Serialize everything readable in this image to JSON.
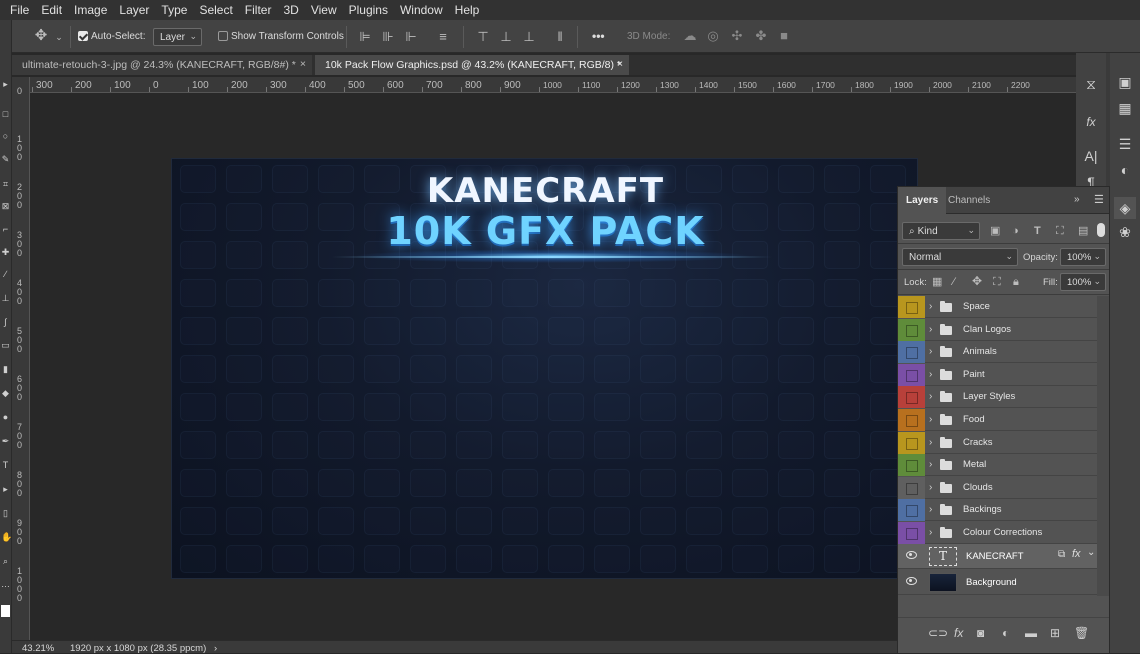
{
  "menu": [
    "File",
    "Edit",
    "Image",
    "Layer",
    "Type",
    "Select",
    "Filter",
    "3D",
    "View",
    "Plugins",
    "Window",
    "Help"
  ],
  "options": {
    "auto_select_label": "Auto-Select:",
    "auto_select_checked": true,
    "auto_select_target": "Layer",
    "show_transform_label": "Show Transform Controls",
    "show_transform_checked": false,
    "more_label": "•••",
    "mode_3d_label": "3D Mode:"
  },
  "tabs": [
    {
      "label": "ultimate-retouch-3-.jpg @ 24.3% (KANECRAFT, RGB/8#) *",
      "active": false
    },
    {
      "label": "10k Pack Flow Graphics.psd @ 43.2% (KANECRAFT, RGB/8) *",
      "active": true
    }
  ],
  "ruler": {
    "h_labels": [
      "300",
      "200",
      "100",
      "0",
      "100",
      "200",
      "300",
      "400",
      "500",
      "600",
      "700",
      "800",
      "900",
      "1000",
      "1100",
      "1200",
      "1300",
      "1400",
      "1500",
      "1600",
      "1700",
      "1800",
      "1900",
      "2000",
      "2100",
      "2200"
    ],
    "v_labels": [
      "0",
      "1 0 0",
      "2 0 0",
      "3 0 0",
      "4 0 0",
      "5 0 0",
      "6 0 0",
      "7 0 0",
      "8 0 0",
      "9 0 0",
      "1 0 0 0"
    ]
  },
  "document": {
    "title_line1": "KANECRAFT",
    "title_line2": "10K GFX PACK"
  },
  "layers_panel": {
    "tabs": [
      "Layers",
      "Channels"
    ],
    "filter_kind": "Kind",
    "blend_mode": "Normal",
    "opacity_label": "Opacity:",
    "opacity": "100%",
    "lock_label": "Lock:",
    "fill_label": "Fill:",
    "fill": "100%",
    "groups": [
      {
        "name": "Space",
        "color": "#b8961e"
      },
      {
        "name": "Clan Logos",
        "color": "#5f8c3a"
      },
      {
        "name": "Animals",
        "color": "#4f6fa3"
      },
      {
        "name": "Paint",
        "color": "#7a4fa6"
      },
      {
        "name": "Layer Styles",
        "color": "#b8403a"
      },
      {
        "name": "Food",
        "color": "#b8701e"
      },
      {
        "name": "Cracks",
        "color": "#b8961e"
      },
      {
        "name": "Metal",
        "color": "#5f8c3a"
      },
      {
        "name": "Clouds",
        "color": "#5f5f5f"
      },
      {
        "name": "Backings",
        "color": "#4f6fa3"
      },
      {
        "name": "Colour Corrections",
        "color": "#7a4fa6"
      }
    ],
    "text_layer": {
      "name": "KANECRAFT",
      "glyph": "T"
    },
    "bg_layer": {
      "name": "Background"
    }
  },
  "status": {
    "zoom": "43.21%",
    "doc_info": "1920 px x 1080 px (28.35 ppcm)"
  },
  "colors": {
    "accent": "#6fd3ff",
    "panel": "#535353",
    "canvas_bg": "#282828"
  }
}
